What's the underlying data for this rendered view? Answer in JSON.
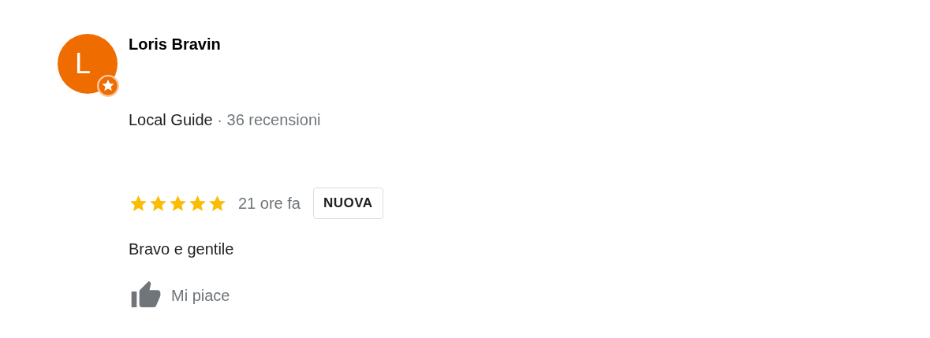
{
  "review": {
    "avatar_letter": "L",
    "author": "Loris Bravin",
    "guide_label": "Local Guide",
    "review_count": "· 36 recensioni",
    "stars": 5,
    "time": "21 ore fa",
    "tag": "NUOVA",
    "text": "Bravo e gentile",
    "like_label": "Mi piace"
  }
}
